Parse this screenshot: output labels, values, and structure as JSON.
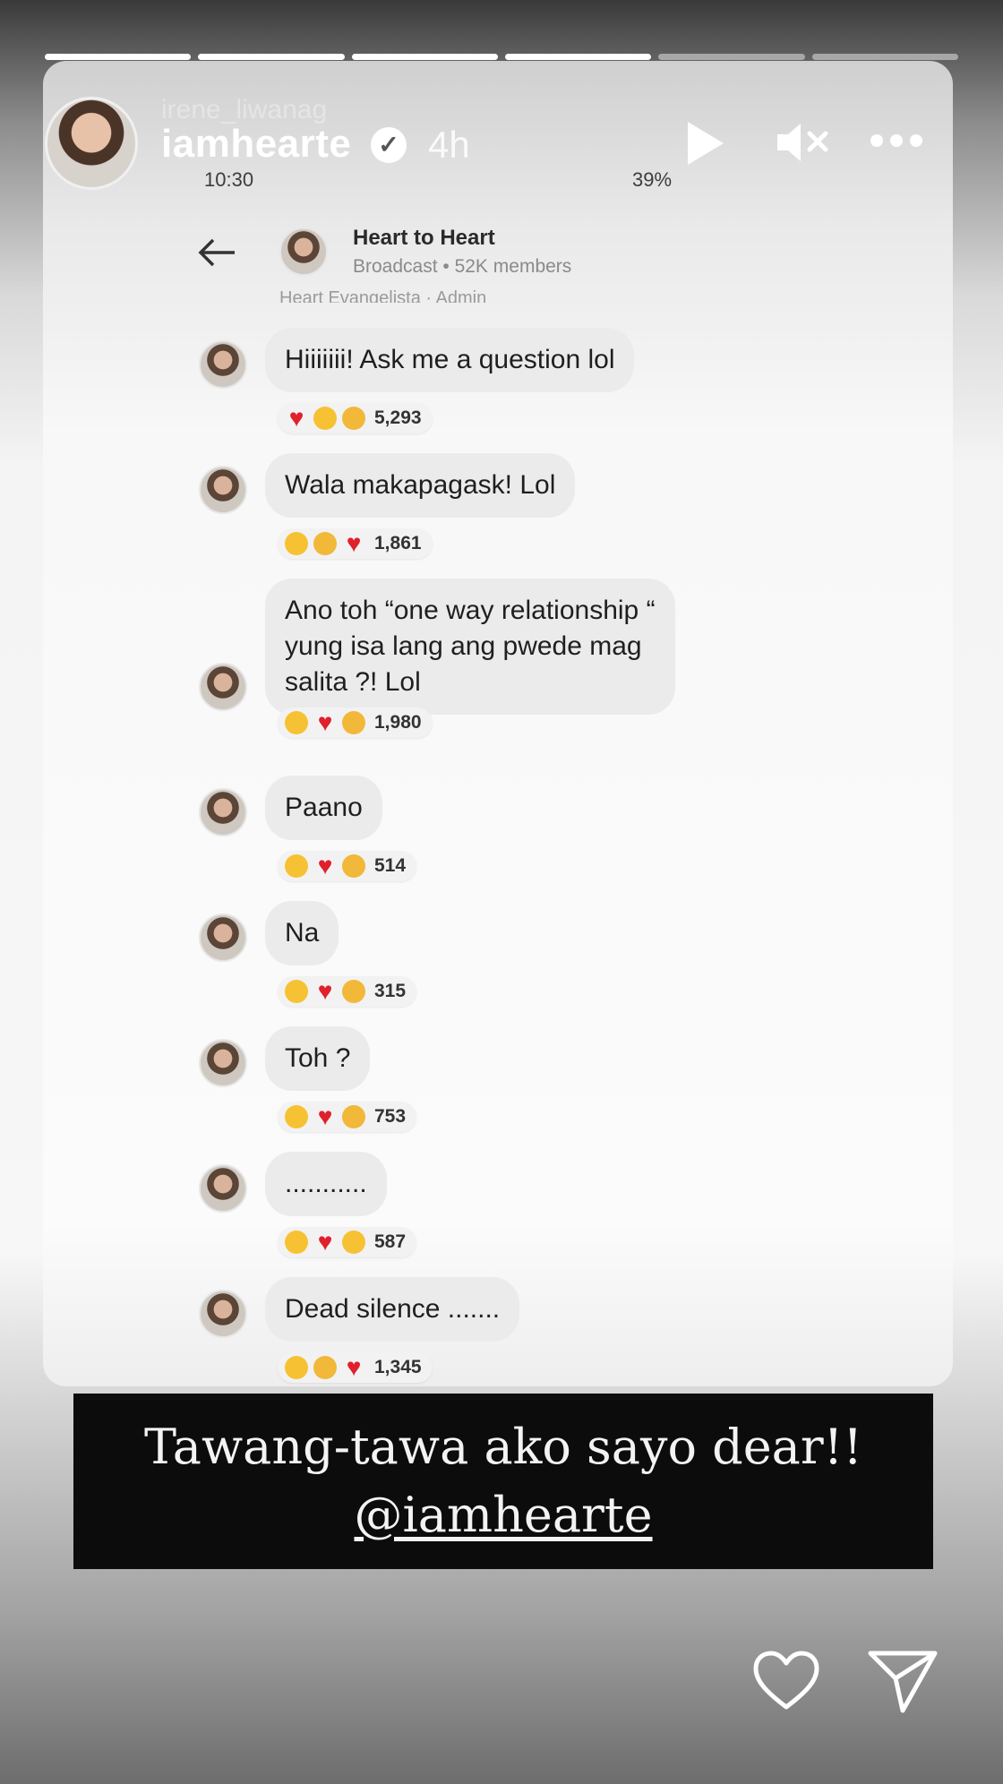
{
  "story": {
    "progress_segments": [
      1,
      1,
      1,
      1,
      0,
      0
    ],
    "ghost_username": "irene_liwanag",
    "username": "iamhearte",
    "time_ago": "4h"
  },
  "screenshot": {
    "status_time": "10:30",
    "status_right": "39%",
    "chat_title": "Heart to Heart",
    "chat_subtitle": "Broadcast • 52K members",
    "cutoff_line": "Heart Evangelista · Admin",
    "messages": [
      {
        "text": "Hiiiiiii! Ask me a question lol",
        "reactions": [
          "heart",
          "laugh",
          "sad"
        ],
        "count": "5,293"
      },
      {
        "text": "Wala makapagask! Lol",
        "reactions": [
          "laugh",
          "sad",
          "heart"
        ],
        "count": "1,861"
      },
      {
        "text_lines": [
          "Ano toh “one way relationship “",
          "yung isa lang ang pwede mag",
          "salita ?! Lol"
        ],
        "reactions": [
          "laugh",
          "heart",
          "sad"
        ],
        "count": "1,980"
      },
      {
        "text": "Paano",
        "reactions": [
          "laugh",
          "heart",
          "sad"
        ],
        "count": "514"
      },
      {
        "text": "Na",
        "reactions": [
          "laugh",
          "heart",
          "sad"
        ],
        "count": "315"
      },
      {
        "text": "Toh ?",
        "reactions": [
          "laugh",
          "heart",
          "sad"
        ],
        "count": "753"
      },
      {
        "text": "...........",
        "reactions": [
          "laugh",
          "heart",
          "laugh"
        ],
        "count": "587"
      },
      {
        "text": "Dead silence .......",
        "reactions": [
          "laugh",
          "sad",
          "heart"
        ],
        "count": "1,345"
      }
    ]
  },
  "caption": {
    "line1": "Tawang-tawa ako sayo dear!!",
    "mention": "@iamhearte"
  },
  "icons": {
    "play": "play-icon",
    "mute": "mute-icon",
    "more": "more-icon",
    "like": "heart-icon",
    "share": "send-icon",
    "back": "back-arrow-icon"
  }
}
